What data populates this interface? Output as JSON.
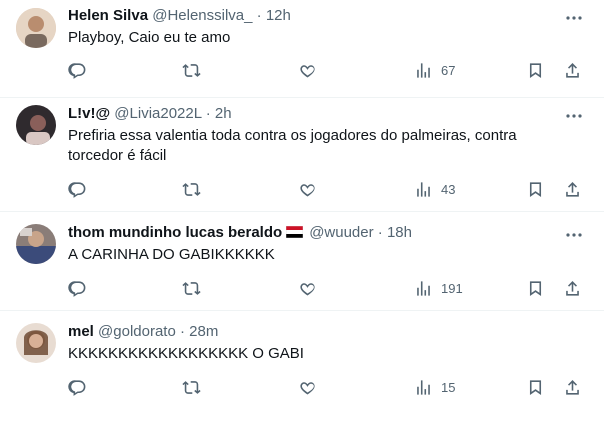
{
  "tweets": [
    {
      "name": "Helen Silva",
      "handle": "@Helenssilva_",
      "sep": "·",
      "time": "12h",
      "text": "Playboy, Caio eu te amo",
      "views": "67",
      "avatar_color": "#c9a58c"
    },
    {
      "name": "L!v!@",
      "handle": "@Livia2022L",
      "sep": "·",
      "time": "2h",
      "text": "Prefiria essa valentia toda contra os jogadores do palmeiras, contra torcedor é fácil",
      "views": "43",
      "avatar_color": "#3a2a2f"
    },
    {
      "name": "thom mundinho lucas beraldo",
      "handle": "@wuuder",
      "sep": "·",
      "time": "18h",
      "text": "A CARINHA DO GABIKKKKKK",
      "views": "191",
      "avatar_color": "#6b5a55",
      "flag": "yemen-flag-icon"
    },
    {
      "name": "mel",
      "handle": "@goldorato",
      "sep": "·",
      "time": "28m",
      "text": "KKKKKKKKKKKKKKKKKK O GABI",
      "views": "15",
      "avatar_color": "#b08a6e"
    }
  ]
}
